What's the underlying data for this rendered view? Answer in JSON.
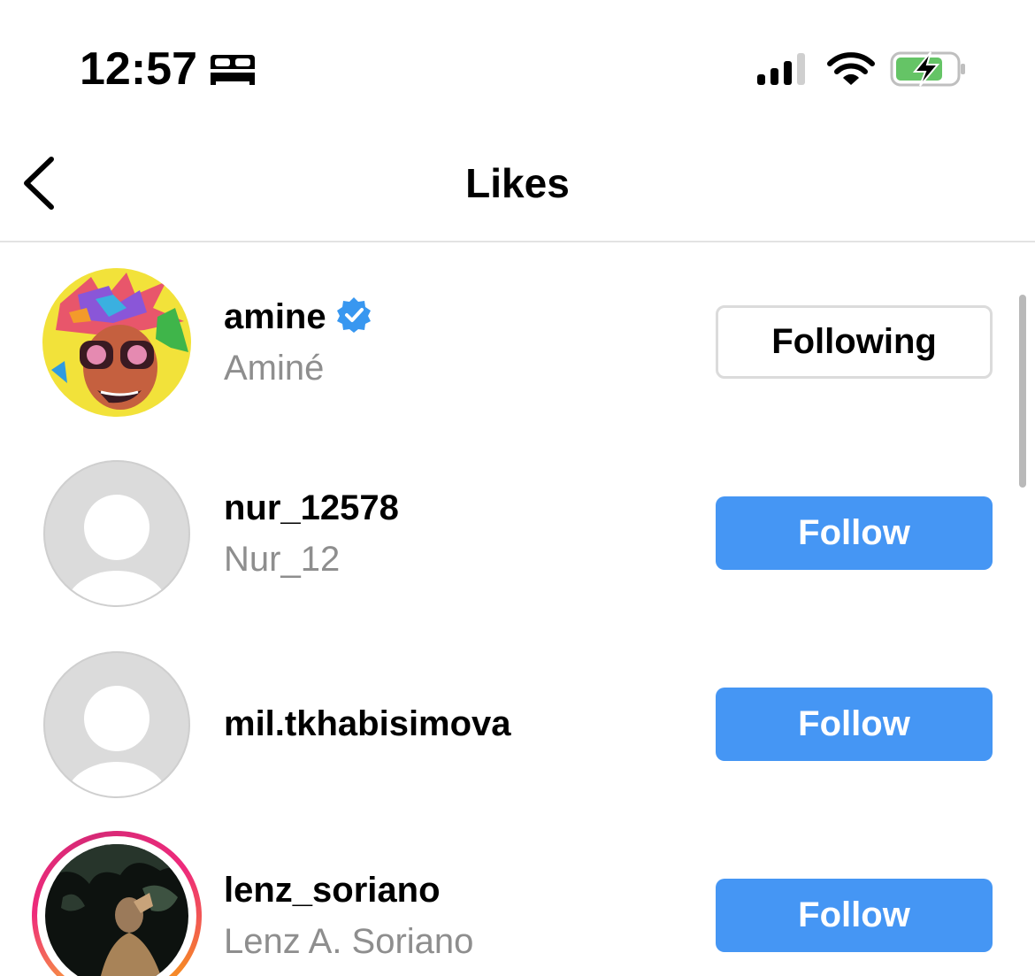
{
  "status_bar": {
    "time": "12:57",
    "sleep_icon": "bed-icon",
    "signal_icon": "cellular-signal-icon",
    "wifi_icon": "wifi-icon",
    "battery_icon": "battery-charging-icon",
    "battery_color": "#65c466"
  },
  "nav": {
    "title": "Likes",
    "back_icon": "chevron-left-icon"
  },
  "colors": {
    "follow_button": "#4596f4",
    "following_border": "#dbdbdb",
    "secondary_text": "#8e8e8e",
    "verified_badge": "#3897f0"
  },
  "likes": [
    {
      "username": "amine",
      "full_name": "Aminé",
      "verified": true,
      "avatar": "illustrated-avatar",
      "button_label": "Following",
      "button_style": "following"
    },
    {
      "username": "nur_12578",
      "full_name": "Nur_12",
      "verified": false,
      "avatar": "default-avatar",
      "button_label": "Follow",
      "button_style": "follow"
    },
    {
      "username": "mil.tkhabisimova",
      "full_name": "",
      "verified": false,
      "avatar": "default-avatar",
      "button_label": "Follow",
      "button_style": "follow"
    },
    {
      "username": "lenz_soriano",
      "full_name": "Lenz A. Soriano",
      "verified": false,
      "avatar": "photo-avatar-with-story-ring",
      "button_label": "Follow",
      "button_style": "follow"
    }
  ]
}
